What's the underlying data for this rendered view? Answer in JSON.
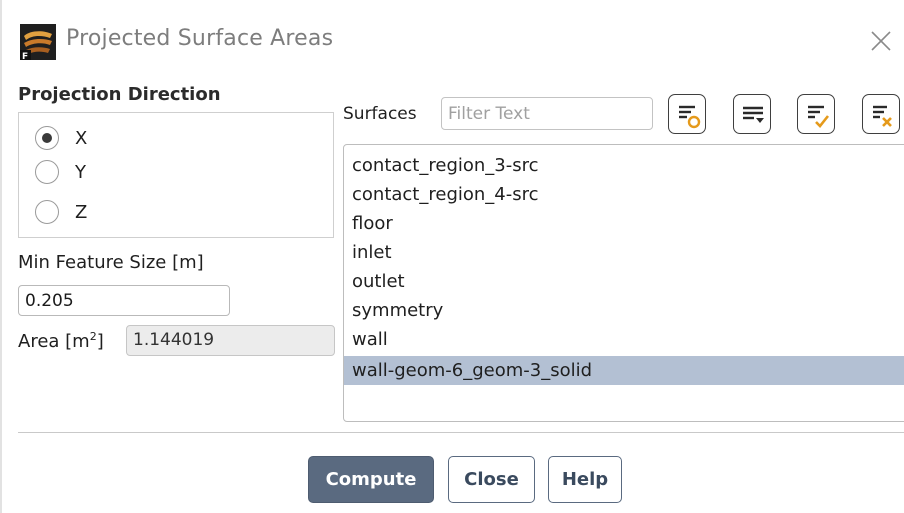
{
  "window": {
    "title": "Projected Surface Areas"
  },
  "projection": {
    "section_label": "Projection Direction",
    "options": [
      {
        "label": "X",
        "selected": true
      },
      {
        "label": "Y",
        "selected": false
      },
      {
        "label": "Z",
        "selected": false
      }
    ]
  },
  "min_feature": {
    "label": "Min Feature Size [m]",
    "value": "0.205"
  },
  "area": {
    "label_prefix": "Area [m",
    "label_sup": "2",
    "label_suffix": "]",
    "value": "1.144019"
  },
  "surfaces": {
    "label": "Surfaces",
    "filter_placeholder": "Filter Text",
    "filter_value": "",
    "toolbar_icons": [
      "select-icon",
      "list-dropdown-icon",
      "select-all-icon",
      "deselect-all-icon"
    ],
    "items": [
      {
        "label": "contact_region_3-src",
        "selected": false
      },
      {
        "label": "contact_region_4-src",
        "selected": false
      },
      {
        "label": "floor",
        "selected": false
      },
      {
        "label": "inlet",
        "selected": false
      },
      {
        "label": "outlet",
        "selected": false
      },
      {
        "label": "symmetry",
        "selected": false
      },
      {
        "label": "wall",
        "selected": false
      },
      {
        "label": "wall-geom-6_geom-3_solid",
        "selected": true
      }
    ]
  },
  "buttons": {
    "compute": "Compute",
    "close": "Close",
    "help": "Help"
  },
  "colors": {
    "selection": "#b3c0d3",
    "primary_button": "#5a6a80",
    "title_text": "#7d7d7d"
  }
}
